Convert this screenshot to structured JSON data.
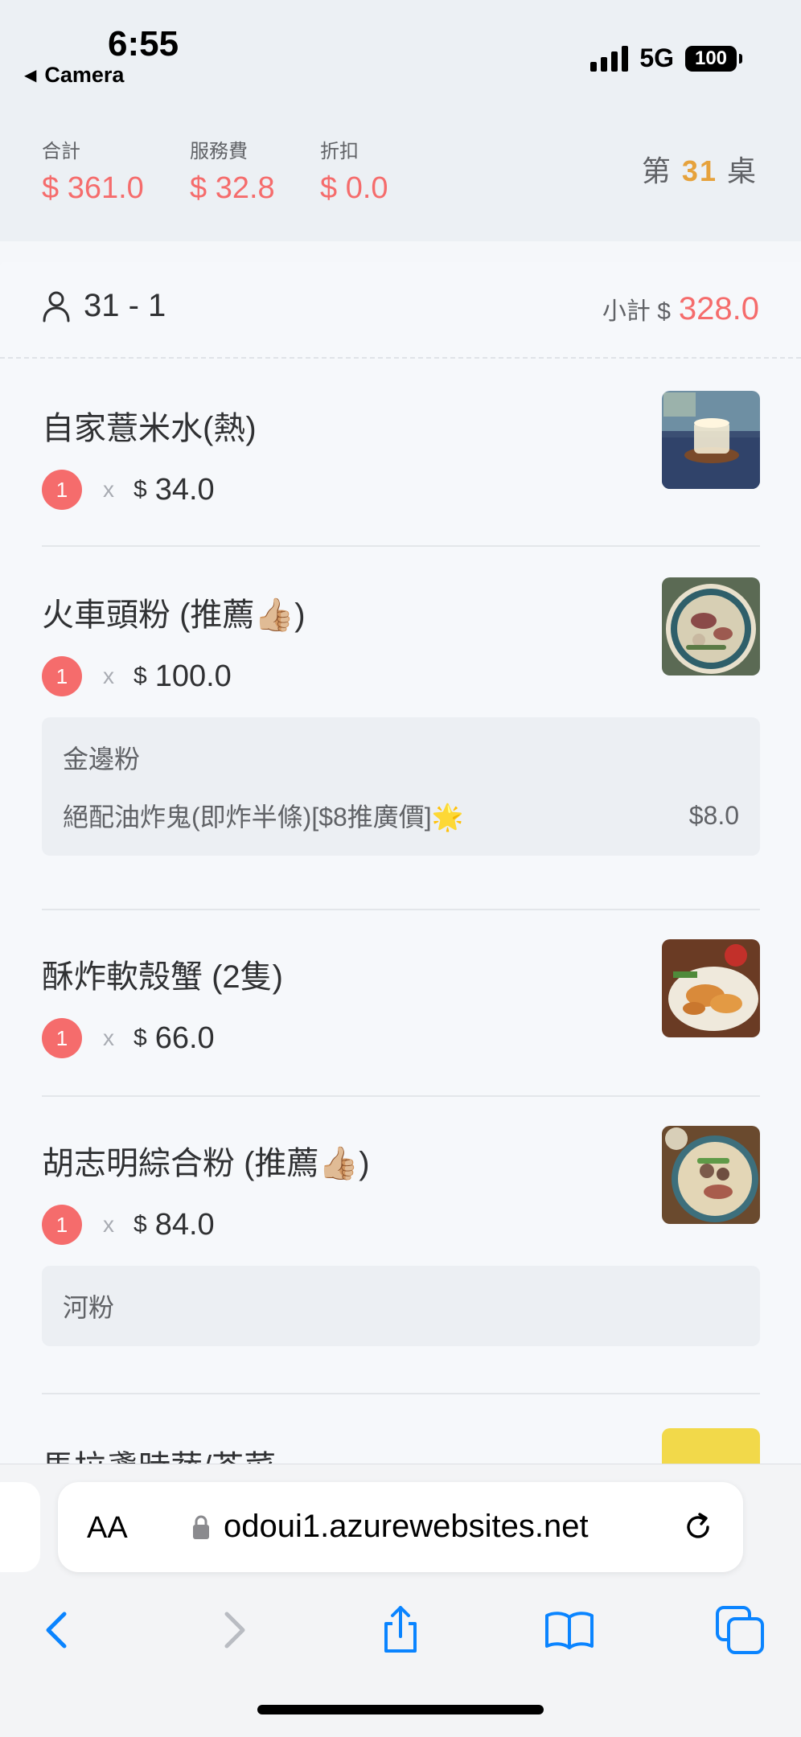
{
  "status_bar": {
    "time": "6:55",
    "back_label": "Camera",
    "network": "5G",
    "battery": "100"
  },
  "summary": {
    "total_label": "合計",
    "total_value": "$ 361.0",
    "service_label": "服務費",
    "service_value": "$ 32.8",
    "discount_label": "折扣",
    "discount_value": "$ 0.0",
    "table_prefix": "第",
    "table_number": "31",
    "table_suffix": "桌"
  },
  "order": {
    "guest": "31 - 1",
    "subtotal_label": "小計 $",
    "subtotal_value": "328.0",
    "items": [
      {
        "name": "自家薏米水(熱)",
        "qty": "1",
        "x": "x",
        "currency": "$",
        "price": "34.0",
        "image": "barley-water-photo"
      },
      {
        "name": "火車頭粉 (推薦👍🏼)",
        "qty": "1",
        "x": "x",
        "currency": "$",
        "price": "100.0",
        "image": "beef-noodle-photo",
        "options": [
          {
            "text": "金邊粉",
            "price": ""
          },
          {
            "text": "絕配油炸鬼(即炸半條)[$8推廣價]🌟",
            "price": "$8.0"
          }
        ]
      },
      {
        "name": "酥炸軟殼蟹 (2隻)",
        "qty": "1",
        "x": "x",
        "currency": "$",
        "price": "66.0",
        "image": "fried-crab-photo"
      },
      {
        "name": "胡志明綜合粉 (推薦👍🏼)",
        "qty": "1",
        "x": "x",
        "currency": "$",
        "price": "84.0",
        "image": "mixed-noodle-photo",
        "options": [
          {
            "text": "河粉",
            "price": ""
          }
        ]
      },
      {
        "name": "馬拉盞時蔬/芥菜",
        "image": "vegetable-photo"
      }
    ]
  },
  "browser": {
    "text_size_label": "AA",
    "url": "odoui1.azurewebsites.net"
  },
  "colors": {
    "accent_red": "#f56c6c",
    "table_orange": "#e6a23c",
    "ios_blue": "#0a84ff"
  },
  "icons": [
    "person-icon",
    "lock-icon",
    "reload-icon",
    "back-icon",
    "forward-icon",
    "share-icon",
    "bookmarks-icon",
    "tabs-icon"
  ]
}
